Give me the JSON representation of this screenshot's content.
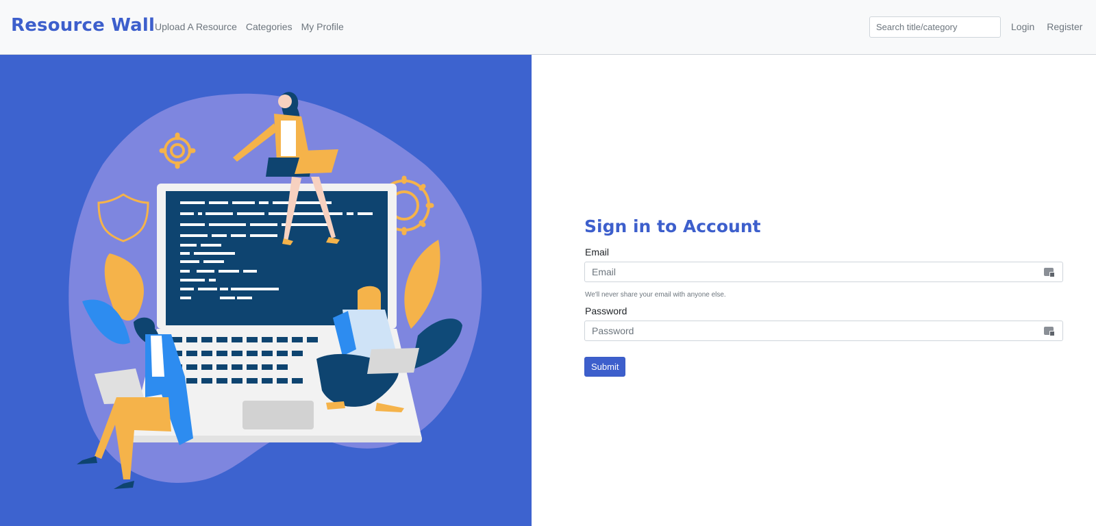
{
  "nav": {
    "brand": "Resource Wall",
    "links": [
      "Upload A Resource",
      "Categories",
      "My Profile"
    ],
    "search_placeholder": "Search title/category",
    "right_links": [
      "Login",
      "Register"
    ]
  },
  "form": {
    "title": "Sign in to Account",
    "email_label": "Email",
    "email_placeholder": "Email",
    "email_help": "We'll never share your email with anyone else.",
    "password_label": "Password",
    "password_placeholder": "Password",
    "submit_label": "Submit"
  },
  "colors": {
    "brand": "#3d5fcc",
    "hero_bg": "#3d63cf",
    "navbar_bg": "#f8f9fa"
  }
}
